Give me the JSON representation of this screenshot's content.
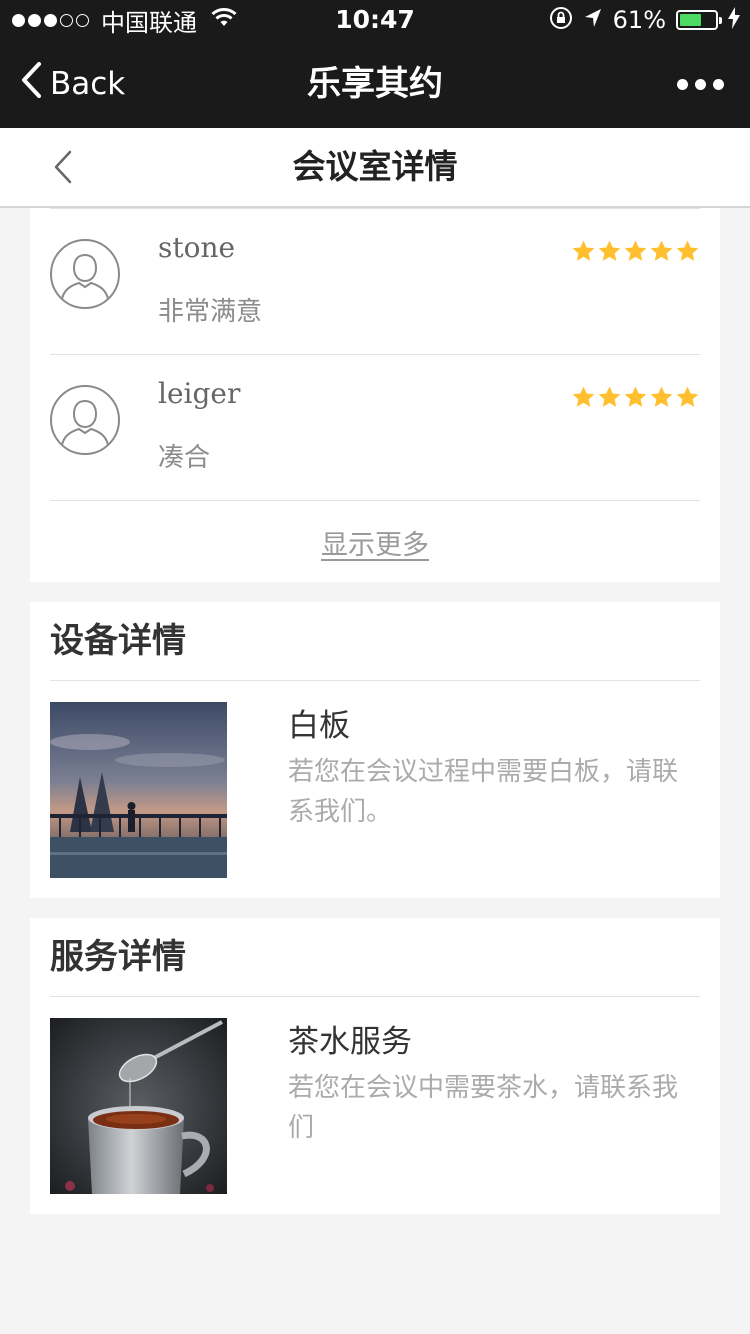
{
  "status_bar": {
    "carrier": "中国联通",
    "time": "10:47",
    "battery_percent": "61%",
    "battery_level": 0.61,
    "signal_bars_filled": 3,
    "signal_bars_total": 5
  },
  "nav": {
    "back_label": "Back",
    "title": "乐享其约"
  },
  "header": {
    "title": "会议室详情"
  },
  "reviews": {
    "items": [
      {
        "name": "stone",
        "comment": "非常满意",
        "rating": 5
      },
      {
        "name": "leiger",
        "comment": "凑合",
        "rating": 5
      }
    ],
    "more_label": "显示更多"
  },
  "equipment": {
    "title": "设备详情",
    "items": [
      {
        "name": "白板",
        "desc": "若您在会议过程中需要白板，请联系我们。"
      }
    ]
  },
  "service": {
    "title": "服务详情",
    "items": [
      {
        "name": "茶水服务",
        "desc": "若您在会议中需要茶水，请联系我们"
      }
    ]
  },
  "colors": {
    "star": "#FFBF2F",
    "nav_bg": "#1A1A1A",
    "battery": "#4CD964"
  }
}
